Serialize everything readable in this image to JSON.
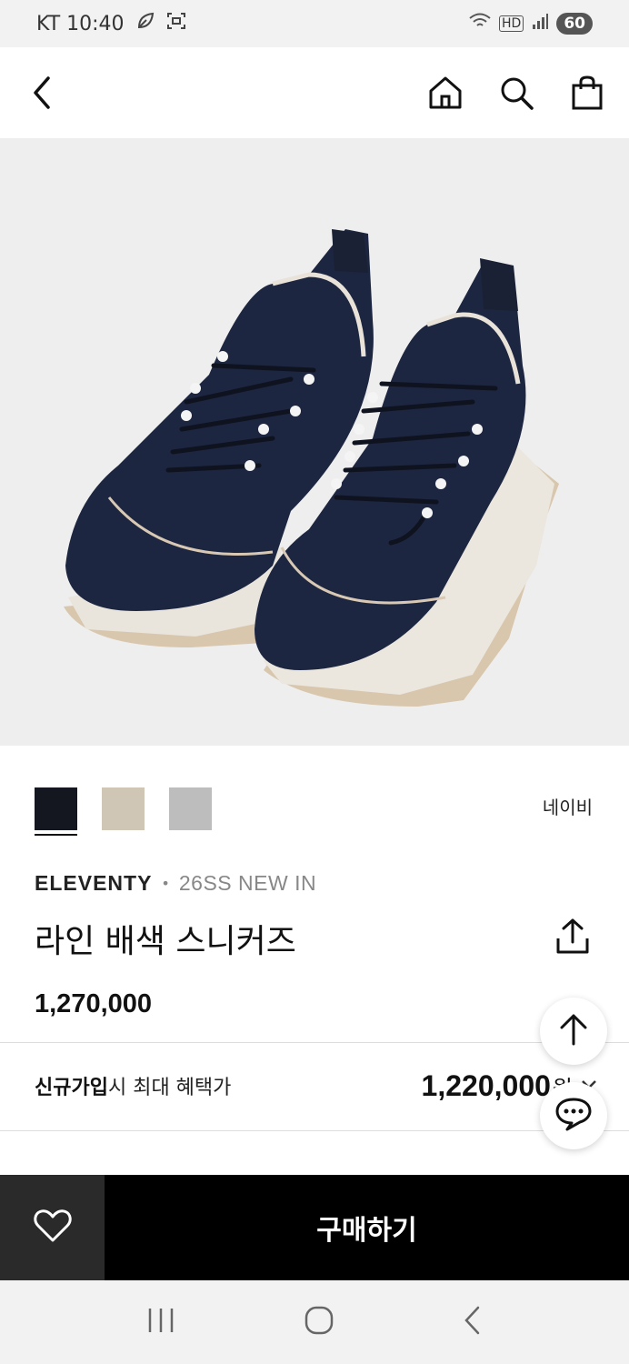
{
  "status_bar": {
    "carrier_time": "KT 10:40",
    "network": "HD",
    "battery": "60"
  },
  "product": {
    "brand": "ELEVENTY",
    "season_tag": "26SS NEW IN",
    "title": "라인 배색 스니커즈",
    "price": "1,270,000",
    "selected_color": "네이비",
    "swatch_colors": [
      "#141620",
      "#cfc6b6",
      "#bdbdbd"
    ]
  },
  "benefit": {
    "strong": "신규가입",
    "rest": "시 최대 혜택가",
    "price": "1,220,000",
    "unit": "원"
  },
  "buy_bar": {
    "buy_label": "구매하기"
  },
  "icons": [
    "back-icon",
    "home-icon",
    "search-icon",
    "shopping-bag-icon",
    "share-icon",
    "arrow-up-icon",
    "chat-icon",
    "heart-icon",
    "recent-apps-icon",
    "home-circle-icon",
    "back-arrow-icon"
  ]
}
